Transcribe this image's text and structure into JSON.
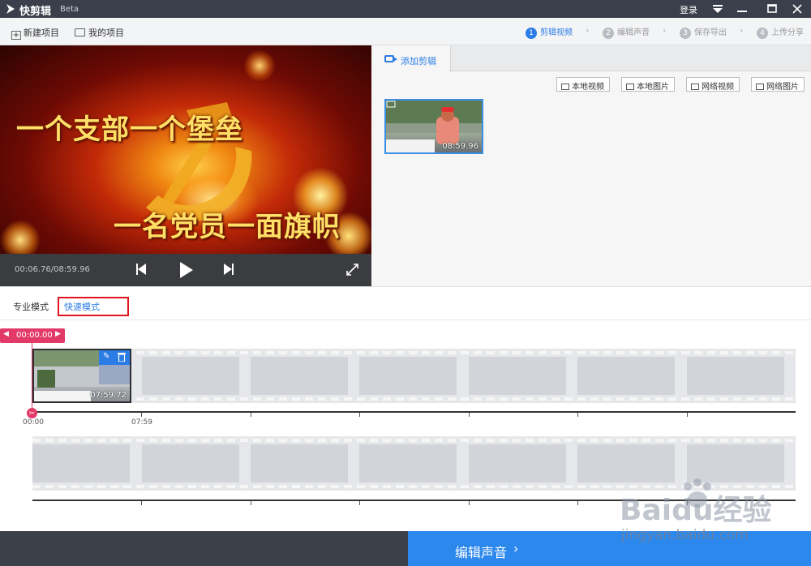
{
  "app": {
    "title": "快剪辑",
    "badge": "Beta",
    "login": "登录"
  },
  "toolbar": {
    "new_project": "新建项目",
    "my_projects": "我的项目"
  },
  "steps": [
    {
      "num": "1",
      "label": "剪辑视频"
    },
    {
      "num": "2",
      "label": "编辑声音"
    },
    {
      "num": "3",
      "label": "保存导出"
    },
    {
      "num": "4",
      "label": "上传分享"
    }
  ],
  "preview": {
    "line1": "一个支部一个堡垒",
    "line2": "一名党员一面旗帜",
    "time": "00:06.76/08:59.96"
  },
  "right_panel": {
    "tab": "添加剪辑",
    "buttons": [
      "本地视频",
      "本地图片",
      "网络视频",
      "网络图片"
    ],
    "clip_duration": "08:59.96"
  },
  "modes": {
    "pro": "专业模式",
    "quick": "快速模式"
  },
  "timeline": {
    "playhead": "00:00.00",
    "clip_duration": "07:59.72",
    "start_label": "00:00",
    "mid_label": "07:59"
  },
  "bottom": {
    "next": "编辑声音"
  },
  "watermark": {
    "logo": "Baidu经验",
    "url": "jingyan.baidu.com"
  },
  "colors": {
    "accent": "#2c88ec",
    "playhead": "#e23a68",
    "highlight": "#e0141e"
  }
}
